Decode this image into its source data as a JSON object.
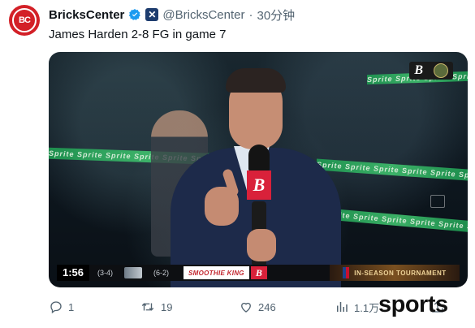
{
  "author": {
    "avatar_text": "BC",
    "name": "BricksCenter",
    "handle": "@BricksCenter",
    "separator": "·",
    "time": "30分钟",
    "verified_color": "#1d9bf0",
    "affiliate_badge_icon": "x-logo"
  },
  "tweet": {
    "text": "James Harden 2-8 FG in game 7"
  },
  "video": {
    "scorebar": {
      "clock": "1:56",
      "team1_record": "(3-4)",
      "team2_record": "(6-2)",
      "sponsor": "SMOOTHIE KING",
      "sponsor_b": "B",
      "tournament": "IN-SEASON TOURNAMENT"
    },
    "led_text": "Sprite  Sprite  Sprite  Sprite  Sprite  Sprite  Sprite",
    "logo_letter": "B",
    "mic_flag_letter": "B"
  },
  "actions": {
    "replies": "1",
    "retweets": "19",
    "likes": "246",
    "views": "1.1万"
  },
  "watermark": "sports",
  "colors": {
    "brand_red": "#d32027",
    "text": "#0f1419",
    "muted": "#536471"
  }
}
